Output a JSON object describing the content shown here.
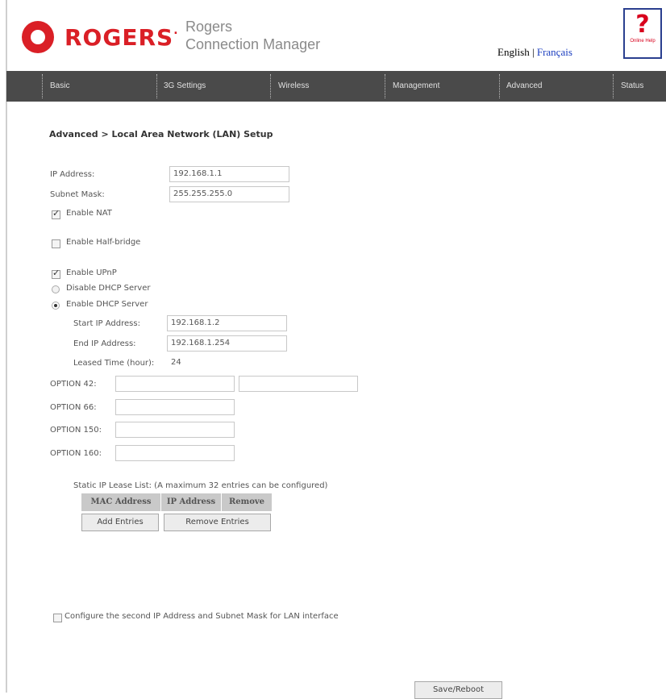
{
  "header": {
    "brand": "ROGERS",
    "brand_mark": ".",
    "product_line1": "Rogers",
    "product_line2": "Connection Manager",
    "lang_english": "English",
    "lang_separator": "|",
    "lang_french": "Français",
    "help_label": "Online Help"
  },
  "nav": [
    "Basic",
    "3G Settings",
    "Wireless",
    "Management",
    "Advanced",
    "Status"
  ],
  "breadcrumb": "Advanced > Local Area Network (LAN) Setup",
  "form": {
    "ip_label": "IP Address:",
    "ip_value": "192.168.1.1",
    "mask_label": "Subnet Mask:",
    "mask_value": "255.255.255.0",
    "nat_label": "Enable NAT",
    "nat_checked": true,
    "halfbridge_label": "Enable Half-bridge",
    "halfbridge_checked": false,
    "upnp_label": "Enable UPnP",
    "upnp_checked": true,
    "dhcp_disable_label": "Disable DHCP Server",
    "dhcp_enable_label": "Enable DHCP Server",
    "dhcp_selected": "enable",
    "start_label": "Start IP Address:",
    "start_value": "192.168.1.2",
    "end_label": "End IP Address:",
    "end_value": "192.168.1.254",
    "lease_label": "Leased Time (hour):",
    "lease_value": "24",
    "opt42_label": "OPTION 42:",
    "opt66_label": "OPTION 66:",
    "opt150_label": "OPTION 150:",
    "opt160_label": "OPTION 160:"
  },
  "static_lease": {
    "title": "Static IP Lease List: (A maximum 32 entries can be configured)",
    "columns": [
      "MAC Address",
      "IP Address",
      "Remove"
    ],
    "add_button": "Add Entries",
    "remove_button": "Remove Entries"
  },
  "second_ip_label": "Configure the second IP Address and Subnet Mask for LAN interface",
  "second_ip_checked": false,
  "save_button": "Save/Reboot",
  "colors": {
    "brand_red": "#da1f26",
    "nav_bg": "#4a4a4a",
    "link_blue": "#1a3dbf"
  }
}
